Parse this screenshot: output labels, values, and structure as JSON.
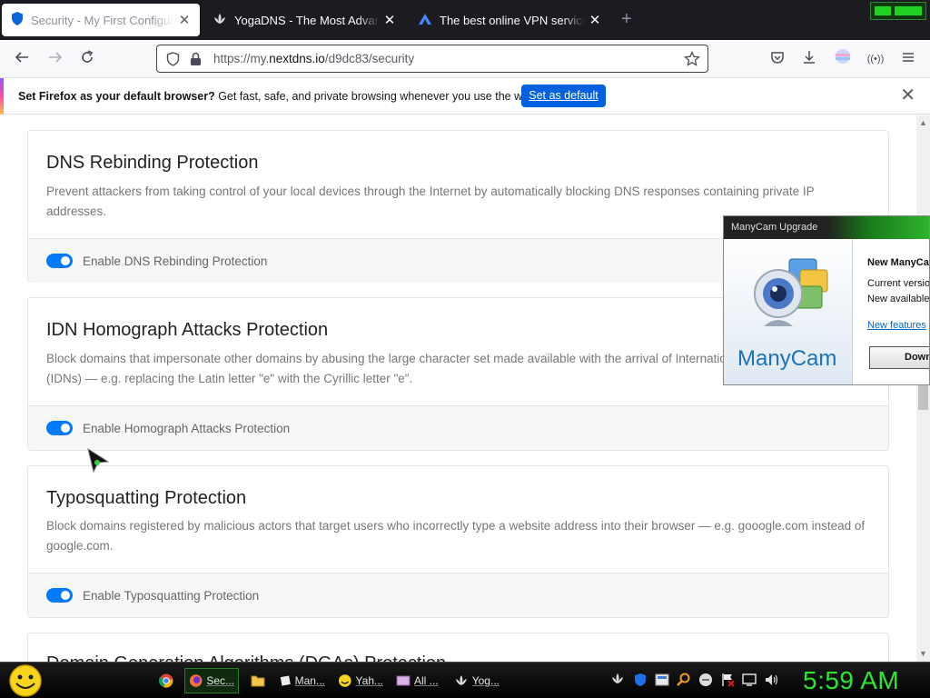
{
  "browser": {
    "tabs": [
      {
        "title": "Security - My First Configuration",
        "icon": "nextdns-shield-icon",
        "active": true
      },
      {
        "title": "YogaDNS - The Most Advanced",
        "icon": "yogadns-lotus-icon",
        "active": false
      },
      {
        "title": "The best online VPN service for",
        "icon": "nordvpn-icon",
        "active": false
      }
    ],
    "url_prefix": "https://my.",
    "url_host": "nextdns.io",
    "url_path": "/d9dc83/security"
  },
  "notification": {
    "bold": "Set Firefox as your default browser?",
    "text": " Get fast, safe, and private browsing whenever you use the web.",
    "button": "Set as default"
  },
  "sections": [
    {
      "title": "DNS Rebinding Protection",
      "description": "Prevent attackers from taking control of your local devices through the Internet by automatically blocking DNS responses containing private IP addresses.",
      "toggle_label": "Enable DNS Rebinding Protection",
      "enabled": true
    },
    {
      "title": "IDN Homograph Attacks Protection",
      "description": "Block domains that impersonate other domains by abusing the large character set made available with the arrival of Internationalized Domain Names (IDNs) — e.g. replacing the Latin letter \"e\" with the Cyrillic letter \"е\".",
      "toggle_label": "Enable Homograph Attacks Protection",
      "enabled": true
    },
    {
      "title": "Typosquatting Protection",
      "description": "Block domains registered by malicious actors that target users who incorrectly type a website address into their browser — e.g. gooogle.com instead of google.com.",
      "toggle_label": "Enable Typosquatting Protection",
      "enabled": true
    },
    {
      "title": "Domain Generation Algorithms (DGAs) Protection"
    }
  ],
  "manycam": {
    "header": "ManyCam Upgrade",
    "brand": "ManyCam",
    "line1": "New ManyCam",
    "line2": "Current version",
    "line3": "New available",
    "link": "New features",
    "button": "Download"
  },
  "taskbar": {
    "items": [
      {
        "label": "Sec...",
        "icon": "firefox-icon",
        "active": true
      },
      {
        "label": "",
        "icon": "folder-icon",
        "active": false
      },
      {
        "label": "Man...",
        "icon": "manycam-icon",
        "active": false
      },
      {
        "label": "Yah...",
        "icon": "yahoo-messenger-icon",
        "active": false
      },
      {
        "label": "All ...",
        "icon": "app-icon",
        "active": false
      },
      {
        "label": "Yog...",
        "icon": "yogadns-lotus-icon",
        "active": false
      }
    ],
    "clock": "5:59 AM"
  },
  "colors": {
    "accent": "#0061e0",
    "toggle_on": "#007bff",
    "clock": "#2ee52e"
  }
}
